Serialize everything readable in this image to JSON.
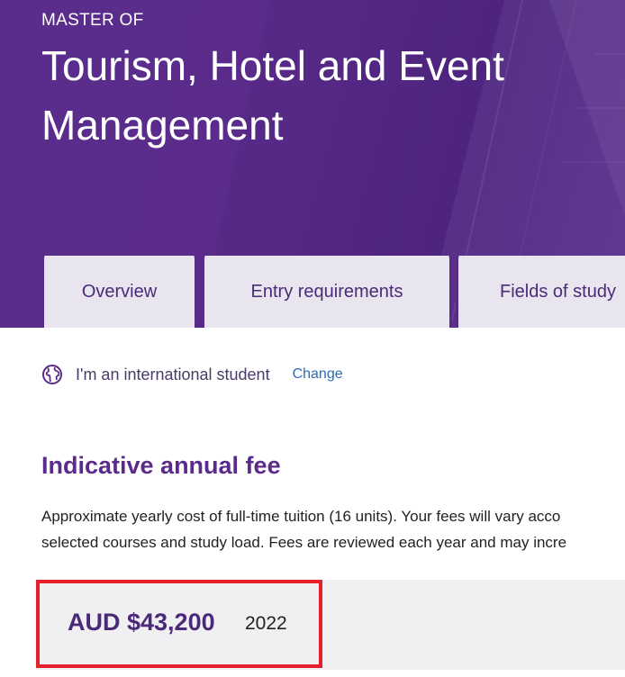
{
  "hero": {
    "eyebrow": "MASTER OF",
    "title": "Tourism, Hotel and Event Management"
  },
  "tabs": [
    {
      "label": "Overview"
    },
    {
      "label": "Entry requirements"
    },
    {
      "label": "Fields of study"
    }
  ],
  "student": {
    "icon": "globe-icon",
    "label": "I'm an international student",
    "change_label": "Change"
  },
  "fees": {
    "heading": "Indicative annual fee",
    "description_line1": "Approximate yearly cost of full-time tuition (16 units). Your fees will vary acco",
    "description_line2": "selected courses and study load. Fees are reviewed each year and may incre",
    "amount": "AUD $43,200",
    "year": "2022"
  },
  "colors": {
    "brand_purple": "#5b2b8b",
    "link_blue": "#2b6cb0",
    "highlight_red": "#e5202a"
  }
}
